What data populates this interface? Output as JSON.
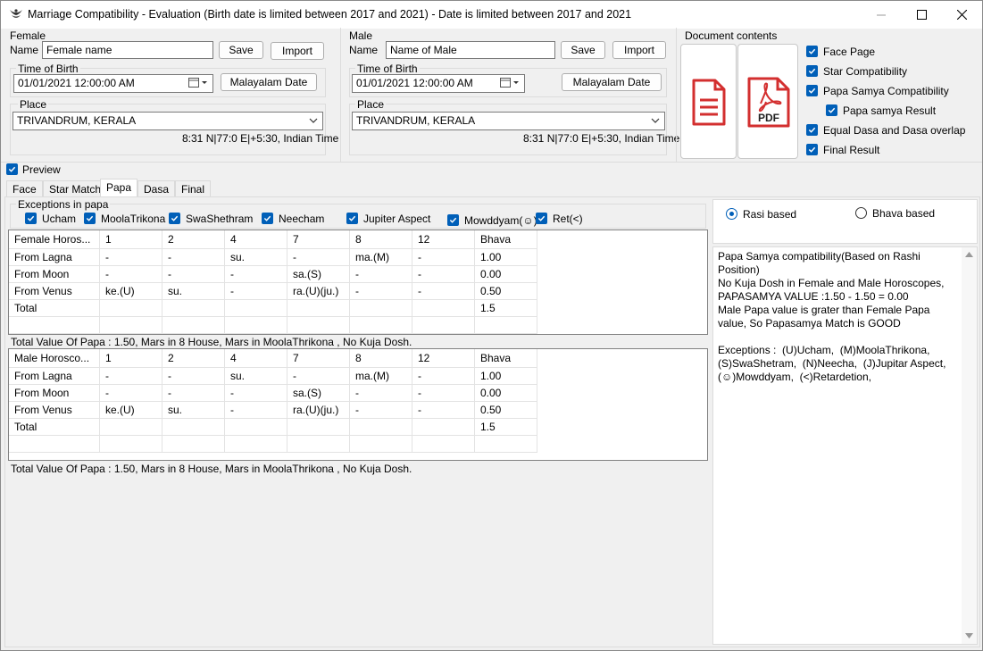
{
  "window": {
    "title": "Marriage  Compatibility - Evaluation  (Birth date is limited between 2017 and 2021)  - Date is limited between 2017 and 2021"
  },
  "female": {
    "section_label": "Female",
    "name_label": "Name",
    "name_value": "Female name",
    "save_label": "Save",
    "import_label": "Import",
    "time_group_label": "Time of Birth",
    "datetime_value": "01/01/2021  12:00:00 AM",
    "malayalam_label": "Malayalam Date",
    "place_group_label": "Place",
    "place_value": "TRIVANDRUM, KERALA",
    "coords": "8:31 N|77:0 E|+5:30, Indian Time"
  },
  "male": {
    "section_label": "Male",
    "name_label": "Name",
    "name_value": "Name of Male",
    "save_label": "Save",
    "import_label": "Import",
    "time_group_label": "Time of Birth",
    "datetime_value": "01/01/2021  12:00:00 AM",
    "malayalam_label": "Malayalam Date",
    "place_group_label": "Place",
    "place_value": "TRIVANDRUM, KERALA",
    "coords": "8:31 N|77:0 E|+5:30, Indian Time"
  },
  "document_contents": {
    "label": "Document contents",
    "pdf_text": "PDF",
    "options": [
      {
        "label": "Face Page",
        "checked": true
      },
      {
        "label": "Star Compatibility",
        "checked": true
      },
      {
        "label": "Papa Samya Compatibility",
        "checked": true
      },
      {
        "label": "Papa samya Result",
        "checked": true
      },
      {
        "label": "Equal Dasa and Dasa overlap",
        "checked": true
      },
      {
        "label": "Final Result",
        "checked": true
      }
    ]
  },
  "preview_label": "Preview",
  "tabs": [
    "Face",
    "Star Match",
    "Papa",
    "Dasa",
    "Final"
  ],
  "active_tab": "Papa",
  "exceptions": {
    "label": "Exceptions in papa",
    "items": [
      "Ucham",
      "MoolaTrikona",
      "SwaShethram",
      "Neecham",
      "Jupiter Aspect",
      "Mowddyam(☺)",
      "Ret(<)"
    ]
  },
  "radio": {
    "rasi": "Rasi based",
    "bhava": "Bhava based",
    "selected": "Rasi based"
  },
  "female_table": {
    "headers": [
      "Female Horos...",
      "1",
      "2",
      "4",
      "7",
      "8",
      "12",
      "Bhava"
    ],
    "rows": [
      [
        "From Lagna",
        "-",
        "-",
        "su.",
        "-",
        "ma.(M)",
        "-",
        "1.00"
      ],
      [
        "From Moon",
        "-",
        "-",
        "-",
        "sa.(S)",
        "-",
        "-",
        "0.00"
      ],
      [
        "From Venus",
        "ke.(U)",
        "su.",
        "-",
        "ra.(U)(ju.)",
        "-",
        "-",
        "0.50"
      ],
      [
        "Total",
        "",
        "",
        "",
        "",
        "",
        "",
        "1.5"
      ]
    ],
    "summary": "Total Value Of Papa : 1.50,  Mars in  8 House,  Mars in  MoolaThrikona , No Kuja Dosh."
  },
  "male_table": {
    "headers": [
      "Male Horosco...",
      "1",
      "2",
      "4",
      "7",
      "8",
      "12",
      "Bhava"
    ],
    "rows": [
      [
        "From Lagna",
        "-",
        "-",
        "su.",
        "-",
        "ma.(M)",
        "-",
        "1.00"
      ],
      [
        "From Moon",
        "-",
        "-",
        "-",
        "sa.(S)",
        "-",
        "-",
        "0.00"
      ],
      [
        "From Venus",
        "ke.(U)",
        "su.",
        "-",
        "ra.(U)(ju.)",
        "-",
        "-",
        "0.50"
      ],
      [
        "Total",
        "",
        "",
        "",
        "",
        "",
        "",
        "1.5"
      ]
    ],
    "summary": "Total Value Of Papa : 1.50,  Mars in  8 House,  Mars in  MoolaThrikona , No Kuja Dosh."
  },
  "result_text": "Papa Samya compatibility(Based on Rashi Position)\nNo Kuja Dosh in Female and Male Horoscopes,\nPAPASAMYA VALUE :1.50 - 1.50 = 0.00\nMale Papa value is grater than Female Papa value, So Papasamya Match is GOOD\n\nExceptions :  (U)Ucham,  (M)MoolaThrikona,\n(S)SwaShetram,  (N)Neecha,  (J)Jupitar Aspect,\n(☺)Mowddyam,  (<)Retardetion,",
  "colors": {
    "accent": "#005fb8",
    "doc_red": "#d32f2f"
  }
}
